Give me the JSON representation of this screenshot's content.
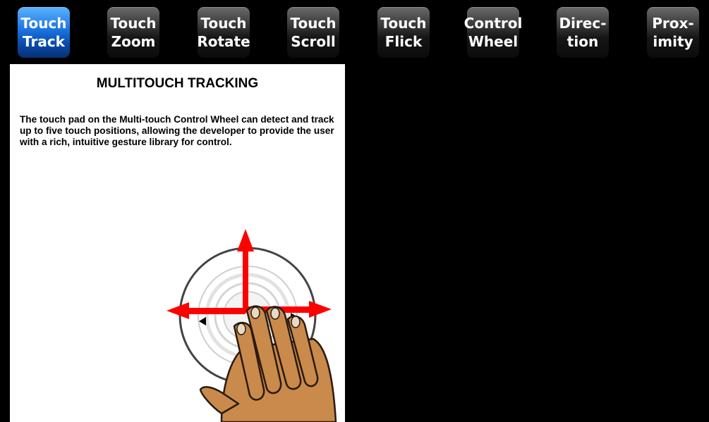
{
  "tabs": [
    {
      "label": "Touch\nTrack",
      "active": true
    },
    {
      "label": "Touch\nZoom",
      "active": false
    },
    {
      "label": "Touch\nRotate",
      "active": false
    },
    {
      "label": "Touch\nScroll",
      "active": false
    },
    {
      "label": "Touch\nFlick",
      "active": false
    },
    {
      "label": "Control\nWheel",
      "active": false
    },
    {
      "label": "Direc-\ntion",
      "active": false
    },
    {
      "label": "Prox-\nimity",
      "active": false
    }
  ],
  "panel": {
    "title": "MULTITOUCH TRACKING",
    "body": "The touch pad on the Multi-touch Control Wheel can detect and track up to five touch positions, allowing the developer to provide the user with a rich, intuitive gesture library for control."
  },
  "illustration": {
    "icons": [
      "control-wheel-icon",
      "arrow-up-icon",
      "arrow-left-icon",
      "arrow-right-icon",
      "hand-icon"
    ]
  },
  "colors": {
    "active_tab": "#1a73e0",
    "arrow": "#ff0000",
    "skin": "#c98a4b",
    "background": "#000000"
  }
}
